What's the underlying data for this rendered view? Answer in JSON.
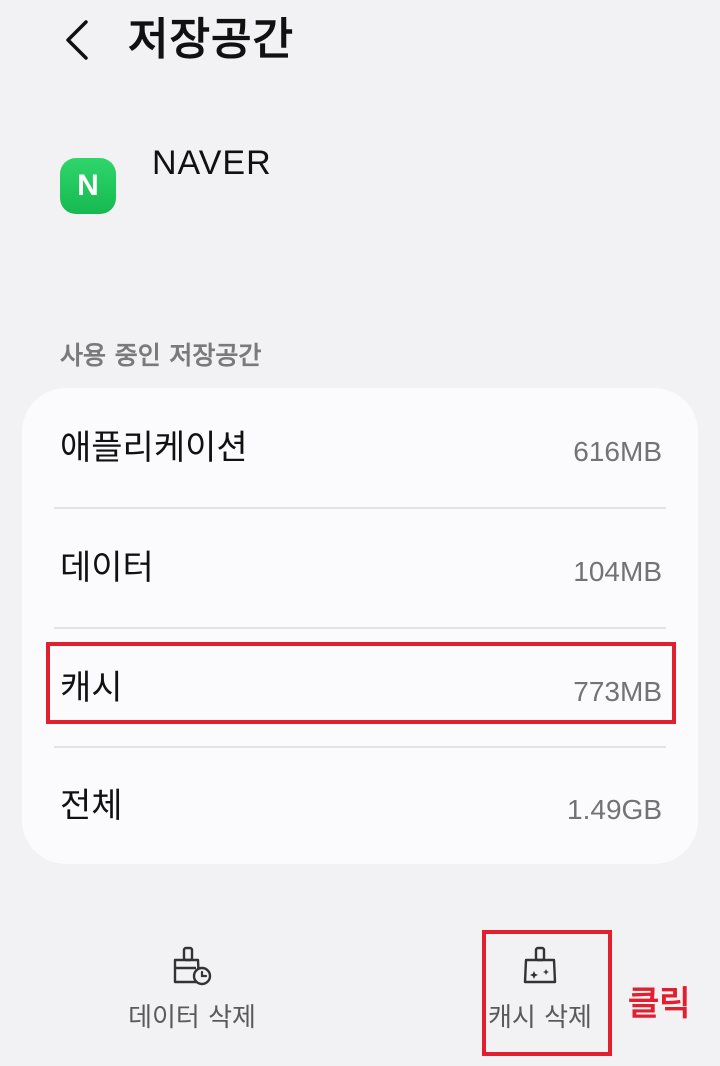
{
  "header": {
    "title": "저장공간",
    "back_icon": "chevron-left-icon"
  },
  "app": {
    "name": "NAVER",
    "icon_letter": "N",
    "icon_color": "#1ec35a"
  },
  "storage": {
    "section_label": "사용 중인 저장공간",
    "rows": [
      {
        "label": "애플리케이션",
        "value": "616MB"
      },
      {
        "label": "데이터",
        "value": "104MB"
      },
      {
        "label": "캐시",
        "value": "773MB"
      },
      {
        "label": "전체",
        "value": "1.49GB"
      }
    ]
  },
  "actions": {
    "clear_data": {
      "label": "데이터 삭제",
      "icon": "broom-data-icon"
    },
    "clear_cache": {
      "label": "캐시 삭제",
      "icon": "broom-sparkle-icon"
    }
  },
  "annotation": {
    "click_label": "클릭",
    "highlight_color": "#e0202e"
  }
}
